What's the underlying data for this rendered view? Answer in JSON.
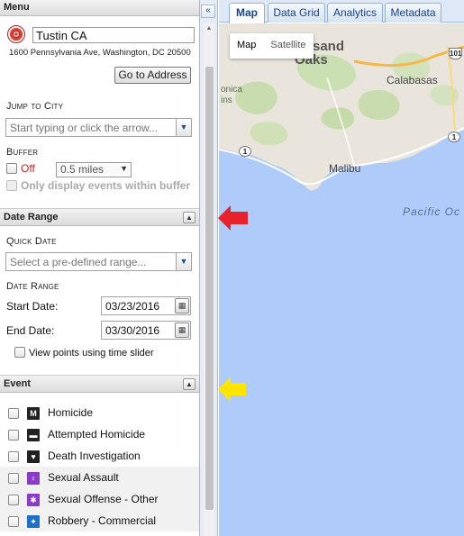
{
  "menu": {
    "title": "Menu",
    "collapse_glyph": "«",
    "search_value": "Tustin CA",
    "address_line": "1600 Pennsylvania Ave, Washington, DC 20500",
    "go_button": "Go to Address",
    "jump_label": "Jump to City",
    "jump_placeholder": "Start typing or click the arrow...",
    "buffer_label": "Buffer",
    "buffer_toggle": "Off",
    "buffer_distance": "0.5 miles",
    "buffer_only": "Only display events within buffer"
  },
  "date_range": {
    "title": "Date Range",
    "quick_label": "Quick Date",
    "quick_placeholder": "Select a pre-defined range...",
    "range_label": "Date Range",
    "start_label": "Start Date:",
    "start_value": "03/23/2016",
    "end_label": "End Date:",
    "end_value": "03/30/2016",
    "slider_label": "View points using time slider"
  },
  "event": {
    "title": "Event",
    "items": [
      {
        "label": "Homicide",
        "icon_color": "#222222",
        "icon_glyph": "M"
      },
      {
        "label": "Attempted Homicide",
        "icon_color": "#222222",
        "icon_glyph": "▬"
      },
      {
        "label": "Death Investigation",
        "icon_color": "#222222",
        "icon_glyph": "♥"
      },
      {
        "label": "Sexual Assault",
        "icon_color": "#8a3cc8",
        "icon_glyph": "♀"
      },
      {
        "label": "Sexual Offense - Other",
        "icon_color": "#8a3cc8",
        "icon_glyph": "✱"
      },
      {
        "label": "Robbery - Commercial",
        "icon_color": "#1e6fc6",
        "icon_glyph": "✦"
      }
    ]
  },
  "tabs": [
    {
      "label": "Map",
      "active": true
    },
    {
      "label": "Data Grid",
      "active": false
    },
    {
      "label": "Analytics",
      "active": false
    },
    {
      "label": "Metadata",
      "active": false
    }
  ],
  "map": {
    "type_map": "Map",
    "type_satellite": "Satellite",
    "labels": {
      "sand": "sand",
      "oaks": "Oaks",
      "calabasas": "Calabasas",
      "malibu": "Malibu",
      "pacific": "Pacific Oc",
      "monica": "onica",
      "ins": "ins"
    },
    "shields": {
      "r101": "101",
      "r1a": "1",
      "r1b": "1"
    },
    "ocean_color": "#aecbfa",
    "land_color": "#e8e4d8"
  },
  "annotations": {
    "red_arrow_color": "#e8222d",
    "yellow_arrow_color": "#ffe600"
  }
}
